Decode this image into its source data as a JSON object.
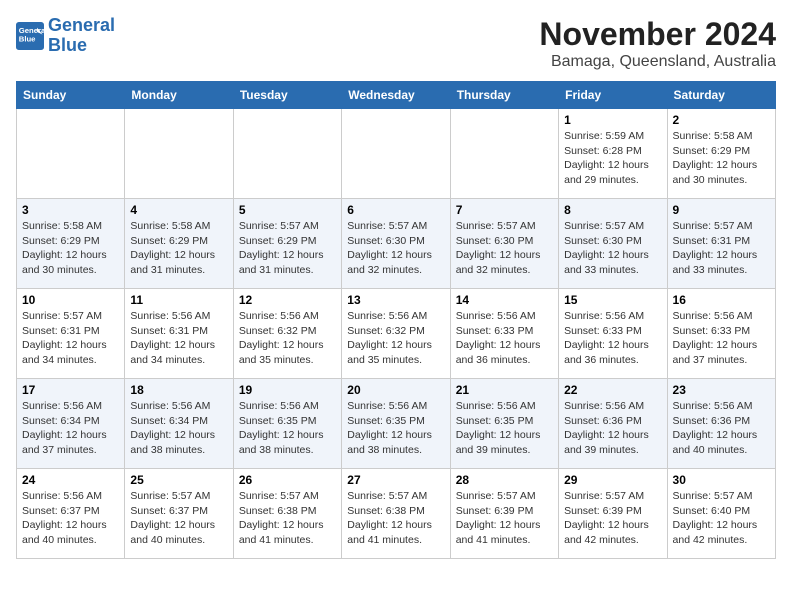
{
  "header": {
    "logo_line1": "General",
    "logo_line2": "Blue",
    "month_title": "November 2024",
    "location": "Bamaga, Queensland, Australia"
  },
  "weekdays": [
    "Sunday",
    "Monday",
    "Tuesday",
    "Wednesday",
    "Thursday",
    "Friday",
    "Saturday"
  ],
  "weeks": [
    [
      {
        "day": "",
        "info": ""
      },
      {
        "day": "",
        "info": ""
      },
      {
        "day": "",
        "info": ""
      },
      {
        "day": "",
        "info": ""
      },
      {
        "day": "",
        "info": ""
      },
      {
        "day": "1",
        "info": "Sunrise: 5:59 AM\nSunset: 6:28 PM\nDaylight: 12 hours\nand 29 minutes."
      },
      {
        "day": "2",
        "info": "Sunrise: 5:58 AM\nSunset: 6:29 PM\nDaylight: 12 hours\nand 30 minutes."
      }
    ],
    [
      {
        "day": "3",
        "info": "Sunrise: 5:58 AM\nSunset: 6:29 PM\nDaylight: 12 hours\nand 30 minutes."
      },
      {
        "day": "4",
        "info": "Sunrise: 5:58 AM\nSunset: 6:29 PM\nDaylight: 12 hours\nand 31 minutes."
      },
      {
        "day": "5",
        "info": "Sunrise: 5:57 AM\nSunset: 6:29 PM\nDaylight: 12 hours\nand 31 minutes."
      },
      {
        "day": "6",
        "info": "Sunrise: 5:57 AM\nSunset: 6:30 PM\nDaylight: 12 hours\nand 32 minutes."
      },
      {
        "day": "7",
        "info": "Sunrise: 5:57 AM\nSunset: 6:30 PM\nDaylight: 12 hours\nand 32 minutes."
      },
      {
        "day": "8",
        "info": "Sunrise: 5:57 AM\nSunset: 6:30 PM\nDaylight: 12 hours\nand 33 minutes."
      },
      {
        "day": "9",
        "info": "Sunrise: 5:57 AM\nSunset: 6:31 PM\nDaylight: 12 hours\nand 33 minutes."
      }
    ],
    [
      {
        "day": "10",
        "info": "Sunrise: 5:57 AM\nSunset: 6:31 PM\nDaylight: 12 hours\nand 34 minutes."
      },
      {
        "day": "11",
        "info": "Sunrise: 5:56 AM\nSunset: 6:31 PM\nDaylight: 12 hours\nand 34 minutes."
      },
      {
        "day": "12",
        "info": "Sunrise: 5:56 AM\nSunset: 6:32 PM\nDaylight: 12 hours\nand 35 minutes."
      },
      {
        "day": "13",
        "info": "Sunrise: 5:56 AM\nSunset: 6:32 PM\nDaylight: 12 hours\nand 35 minutes."
      },
      {
        "day": "14",
        "info": "Sunrise: 5:56 AM\nSunset: 6:33 PM\nDaylight: 12 hours\nand 36 minutes."
      },
      {
        "day": "15",
        "info": "Sunrise: 5:56 AM\nSunset: 6:33 PM\nDaylight: 12 hours\nand 36 minutes."
      },
      {
        "day": "16",
        "info": "Sunrise: 5:56 AM\nSunset: 6:33 PM\nDaylight: 12 hours\nand 37 minutes."
      }
    ],
    [
      {
        "day": "17",
        "info": "Sunrise: 5:56 AM\nSunset: 6:34 PM\nDaylight: 12 hours\nand 37 minutes."
      },
      {
        "day": "18",
        "info": "Sunrise: 5:56 AM\nSunset: 6:34 PM\nDaylight: 12 hours\nand 38 minutes."
      },
      {
        "day": "19",
        "info": "Sunrise: 5:56 AM\nSunset: 6:35 PM\nDaylight: 12 hours\nand 38 minutes."
      },
      {
        "day": "20",
        "info": "Sunrise: 5:56 AM\nSunset: 6:35 PM\nDaylight: 12 hours\nand 38 minutes."
      },
      {
        "day": "21",
        "info": "Sunrise: 5:56 AM\nSunset: 6:35 PM\nDaylight: 12 hours\nand 39 minutes."
      },
      {
        "day": "22",
        "info": "Sunrise: 5:56 AM\nSunset: 6:36 PM\nDaylight: 12 hours\nand 39 minutes."
      },
      {
        "day": "23",
        "info": "Sunrise: 5:56 AM\nSunset: 6:36 PM\nDaylight: 12 hours\nand 40 minutes."
      }
    ],
    [
      {
        "day": "24",
        "info": "Sunrise: 5:56 AM\nSunset: 6:37 PM\nDaylight: 12 hours\nand 40 minutes."
      },
      {
        "day": "25",
        "info": "Sunrise: 5:57 AM\nSunset: 6:37 PM\nDaylight: 12 hours\nand 40 minutes."
      },
      {
        "day": "26",
        "info": "Sunrise: 5:57 AM\nSunset: 6:38 PM\nDaylight: 12 hours\nand 41 minutes."
      },
      {
        "day": "27",
        "info": "Sunrise: 5:57 AM\nSunset: 6:38 PM\nDaylight: 12 hours\nand 41 minutes."
      },
      {
        "day": "28",
        "info": "Sunrise: 5:57 AM\nSunset: 6:39 PM\nDaylight: 12 hours\nand 41 minutes."
      },
      {
        "day": "29",
        "info": "Sunrise: 5:57 AM\nSunset: 6:39 PM\nDaylight: 12 hours\nand 42 minutes."
      },
      {
        "day": "30",
        "info": "Sunrise: 5:57 AM\nSunset: 6:40 PM\nDaylight: 12 hours\nand 42 minutes."
      }
    ]
  ]
}
